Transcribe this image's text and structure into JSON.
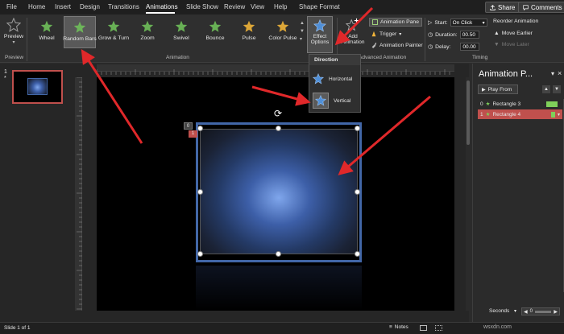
{
  "tabs": [
    "File",
    "Home",
    "Insert",
    "Design",
    "Transitions",
    "Animations",
    "Slide Show",
    "Review",
    "View",
    "Help",
    "Shape Format"
  ],
  "active_tab": "Animations",
  "top_buttons": {
    "share": "Share",
    "comments": "Comments"
  },
  "ribbon": {
    "preview_label": "Preview",
    "preview_group": "Preview",
    "animation_group": "Animation",
    "advanced_group": "Advanced Animation",
    "timing_group": "Timing",
    "gallery": [
      {
        "label": "Wheel",
        "color": "#6fbf5a"
      },
      {
        "label": "Random Bars",
        "color": "#6fbf5a"
      },
      {
        "label": "Grow & Turn",
        "color": "#6fbf5a"
      },
      {
        "label": "Zoom",
        "color": "#6fbf5a"
      },
      {
        "label": "Swivel",
        "color": "#6fbf5a"
      },
      {
        "label": "Bounce",
        "color": "#6fbf5a"
      },
      {
        "label": "Pulse",
        "color": "#f0b43a"
      },
      {
        "label": "Color Pulse",
        "color": "#f0b43a"
      }
    ],
    "effect_options_line1": "Effect",
    "effect_options_line2": "Options",
    "add_animation_line1": "Add",
    "add_animation_line2": "Animation",
    "animation_pane": "Animation Pane",
    "trigger": "Trigger",
    "animation_painter": "Animation Painter",
    "start_label": "Start:",
    "start_value": "On Click",
    "duration_label": "Duration:",
    "duration_value": "00.50",
    "delay_label": "Delay:",
    "delay_value": "00.00",
    "reorder": "Reorder Animation",
    "move_earlier": "Move Earlier",
    "move_later": "Move Later"
  },
  "dropdown": {
    "title": "Direction",
    "options": [
      "Horizontal",
      "Vertical"
    ]
  },
  "slide_number": "1",
  "slide_star": "*",
  "shape_badges": [
    "0",
    "1"
  ],
  "pane": {
    "title": "Animation P...",
    "play_from": "Play From",
    "items": [
      {
        "num": "0",
        "name": "Rectangle 3",
        "bar_color": "#7fd05a",
        "selected": false
      },
      {
        "num": "1",
        "name": "Rectangle 4",
        "bar_color": "#7fd05a",
        "selected": true
      }
    ],
    "seconds": "Seconds",
    "timeline_start": "0"
  },
  "status": {
    "slide": "Slide 1 of 1",
    "notes": "Notes",
    "watermark": "wsxdn.com"
  }
}
